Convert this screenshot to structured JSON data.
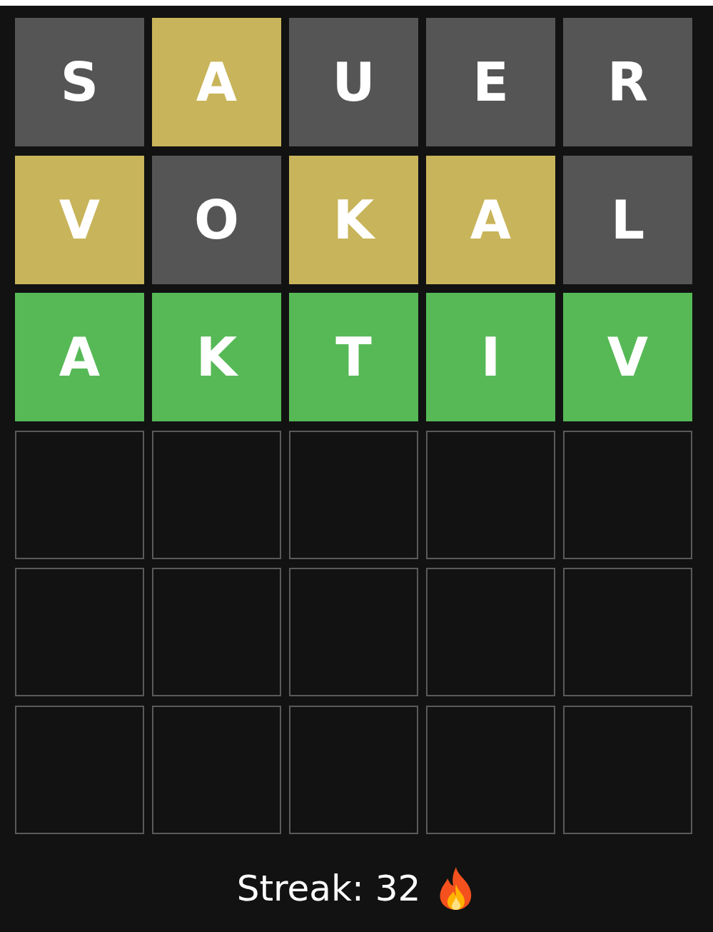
{
  "board": [
    {
      "tiles": [
        {
          "letter": "S",
          "kind": "absent"
        },
        {
          "letter": "A",
          "kind": "present"
        },
        {
          "letter": "U",
          "kind": "absent"
        },
        {
          "letter": "E",
          "kind": "absent"
        },
        {
          "letter": "R",
          "kind": "absent"
        }
      ]
    },
    {
      "tiles": [
        {
          "letter": "V",
          "kind": "present"
        },
        {
          "letter": "O",
          "kind": "absent"
        },
        {
          "letter": "K",
          "kind": "present"
        },
        {
          "letter": "A",
          "kind": "present"
        },
        {
          "letter": "L",
          "kind": "absent"
        }
      ]
    },
    {
      "tiles": [
        {
          "letter": "A",
          "kind": "correct"
        },
        {
          "letter": "K",
          "kind": "correct"
        },
        {
          "letter": "T",
          "kind": "correct"
        },
        {
          "letter": "I",
          "kind": "correct"
        },
        {
          "letter": "V",
          "kind": "correct"
        }
      ]
    },
    {
      "tiles": [
        {
          "kind": "empty"
        },
        {
          "kind": "empty"
        },
        {
          "kind": "empty"
        },
        {
          "kind": "empty"
        },
        {
          "kind": "empty"
        }
      ]
    },
    {
      "tiles": [
        {
          "kind": "empty"
        },
        {
          "kind": "empty"
        },
        {
          "kind": "empty"
        },
        {
          "kind": "empty"
        },
        {
          "kind": "empty"
        }
      ]
    },
    {
      "tiles": [
        {
          "kind": "empty"
        },
        {
          "kind": "empty"
        },
        {
          "kind": "empty"
        },
        {
          "kind": "empty"
        },
        {
          "kind": "empty"
        }
      ]
    }
  ],
  "streak": {
    "label": "Streak: 32"
  }
}
